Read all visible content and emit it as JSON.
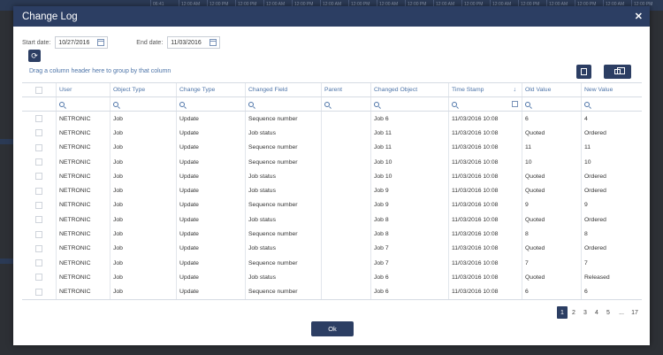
{
  "background": {
    "ticks": [
      "06:41",
      "12:00 AM",
      "12:00 PM",
      "12:00 PM",
      "12:00 AM",
      "12:00 PM",
      "12:00 AM",
      "12:00 PM",
      "12:00 AM",
      "12:00 PM",
      "12:00 AM",
      "12:00 PM",
      "12:00 AM",
      "12:00 PM",
      "12:00 AM",
      "12:00 PM",
      "12:00 AM",
      "12:00 PM"
    ]
  },
  "modal": {
    "title": "Change Log",
    "close_icon": "close-icon",
    "start_label": "Start date:",
    "start_value": "10/27/2016",
    "end_label": "End date:",
    "end_value": "11/03/2016",
    "group_hint": "Drag a column header here to group by that column",
    "ok_label": "Ok"
  },
  "columns": [
    "",
    "User",
    "Object Type",
    "Change Type",
    "Changed Field",
    "Parent",
    "Changed Object",
    "Time Stamp",
    "Old Value",
    "New Value"
  ],
  "rows": [
    [
      "NETRONIC",
      "Job",
      "Update",
      "Sequence number",
      "",
      "Job 6",
      "11/03/2016 10:08",
      "6",
      "4"
    ],
    [
      "NETRONIC",
      "Job",
      "Update",
      "Job status",
      "",
      "Job 11",
      "11/03/2016 10:08",
      "Quoted",
      "Ordered"
    ],
    [
      "NETRONIC",
      "Job",
      "Update",
      "Sequence number",
      "",
      "Job 11",
      "11/03/2016 10:08",
      "11",
      "11"
    ],
    [
      "NETRONIC",
      "Job",
      "Update",
      "Sequence number",
      "",
      "Job 10",
      "11/03/2016 10:08",
      "10",
      "10"
    ],
    [
      "NETRONIC",
      "Job",
      "Update",
      "Job status",
      "",
      "Job 10",
      "11/03/2016 10:08",
      "Quoted",
      "Ordered"
    ],
    [
      "NETRONIC",
      "Job",
      "Update",
      "Job status",
      "",
      "Job 9",
      "11/03/2016 10:08",
      "Quoted",
      "Ordered"
    ],
    [
      "NETRONIC",
      "Job",
      "Update",
      "Sequence number",
      "",
      "Job 9",
      "11/03/2016 10:08",
      "9",
      "9"
    ],
    [
      "NETRONIC",
      "Job",
      "Update",
      "Job status",
      "",
      "Job 8",
      "11/03/2016 10:08",
      "Quoted",
      "Ordered"
    ],
    [
      "NETRONIC",
      "Job",
      "Update",
      "Sequence number",
      "",
      "Job 8",
      "11/03/2016 10:08",
      "8",
      "8"
    ],
    [
      "NETRONIC",
      "Job",
      "Update",
      "Job status",
      "",
      "Job 7",
      "11/03/2016 10:08",
      "Quoted",
      "Ordered"
    ],
    [
      "NETRONIC",
      "Job",
      "Update",
      "Sequence number",
      "",
      "Job 7",
      "11/03/2016 10:08",
      "7",
      "7"
    ],
    [
      "NETRONIC",
      "Job",
      "Update",
      "Job status",
      "",
      "Job 6",
      "11/03/2016 10:08",
      "Quoted",
      "Released"
    ],
    [
      "NETRONIC",
      "Job",
      "Update",
      "Sequence number",
      "",
      "Job 6",
      "11/03/2016 10:08",
      "6",
      "6"
    ]
  ],
  "pagination": {
    "pages": [
      "1",
      "2",
      "3",
      "4",
      "5",
      "...",
      "17"
    ],
    "active": "1"
  },
  "colors": {
    "accent": "#2c3e63",
    "link": "#4d74a8"
  }
}
